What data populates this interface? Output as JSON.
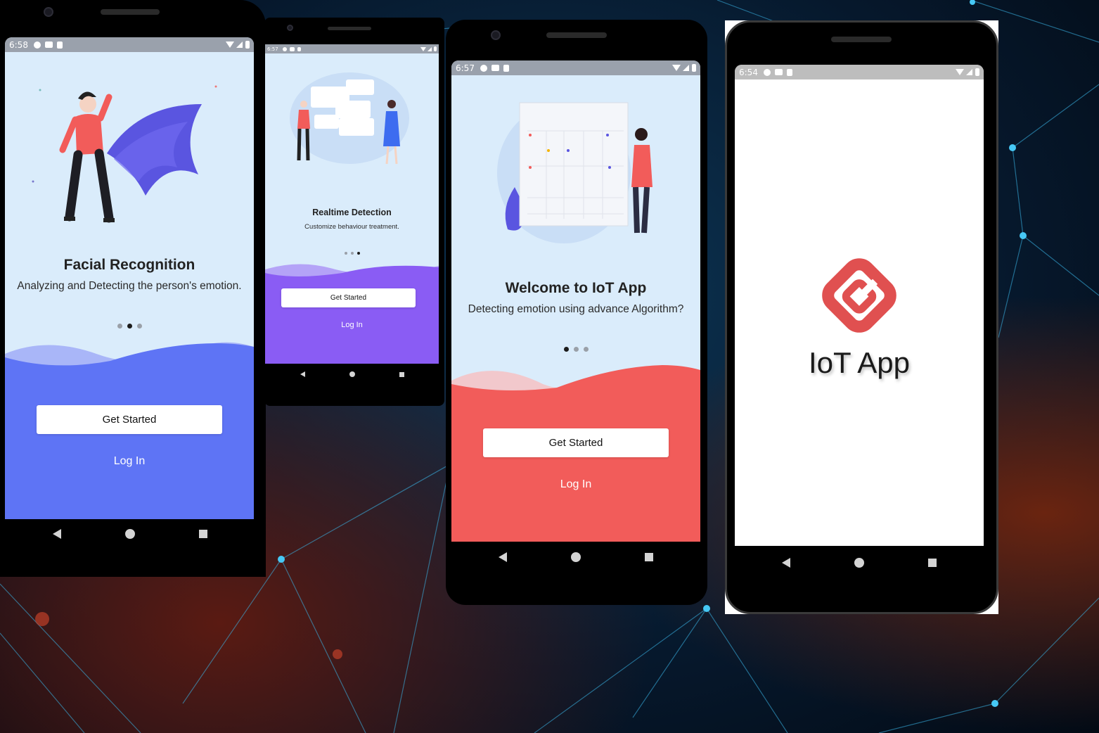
{
  "phones": {
    "facial": {
      "status_time": "6:58",
      "title": "Facial Recognition",
      "subtitle": "Analyzing and Detecting the person's emotion.",
      "active_dot": 2,
      "get_started": "Get Started",
      "log_in": "Log In",
      "accent": "#5e74f5",
      "bg": "#daecfb"
    },
    "realtime": {
      "status_time": "6:57",
      "title": "Realtime Detection",
      "subtitle": "Customize behaviour treatment.",
      "active_dot": 3,
      "get_started": "Get Started",
      "log_in": "Log In",
      "accent": "#8a5cf4",
      "bg": "#daecfb"
    },
    "welcome": {
      "status_time": "6:57",
      "title": "Welcome to IoT App",
      "subtitle": "Detecting emotion using advance Algorithm?",
      "active_dot": 1,
      "get_started": "Get Started",
      "log_in": "Log In",
      "accent": "#f25c5a",
      "bg": "#daecfb"
    },
    "splash": {
      "status_time": "6:54",
      "app_name": "IoT App",
      "logo_color": "#e05050",
      "logo_icon": "iot-logo-icon"
    }
  },
  "nav_icons": [
    "back-icon",
    "home-icon",
    "recents-icon"
  ],
  "status_icons": [
    "settings-icon",
    "gallery-icon",
    "sd-card-icon",
    "wifi-icon",
    "signal-icon",
    "battery-icon"
  ]
}
